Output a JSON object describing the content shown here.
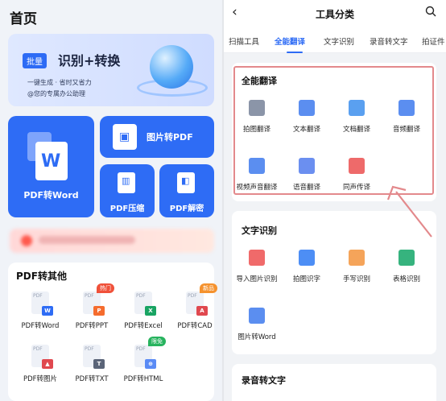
{
  "left": {
    "title": "首页",
    "banner": {
      "tag": "批量",
      "headline": "识别+转换",
      "line1": "一键生成 · 省时又省力",
      "line2": "@您的专属办公助理"
    },
    "cards": {
      "pdf_to_word": "PDF转Word",
      "image_to_pdf": "图片转PDF",
      "pdf_compress": "PDF压缩",
      "pdf_decrypt": "PDF解密"
    },
    "pdf_convert": {
      "title": "PDF转其他",
      "items": [
        {
          "label": "PDF转Word",
          "badge_letter": "W",
          "color": "#2e6cf5"
        },
        {
          "label": "PDF转PPT",
          "badge_letter": "P",
          "color": "#f56c2e",
          "tag": "热门"
        },
        {
          "label": "PDF转Excel",
          "badge_letter": "X",
          "color": "#19a463"
        },
        {
          "label": "PDF转CAD",
          "badge_letter": "A",
          "color": "#e0484f",
          "tag": "新品"
        },
        {
          "label": "PDF转图片",
          "badge_letter": "▲",
          "color": "#e0484f"
        },
        {
          "label": "PDF转TXT",
          "badge_letter": "T",
          "color": "#5a6478"
        },
        {
          "label": "PDF转HTML",
          "badge_letter": "⊕",
          "color": "#5a8bf5",
          "tag": "限免"
        }
      ]
    }
  },
  "right": {
    "title": "工具分类",
    "tabs": [
      "扫描工具",
      "全能翻译",
      "文字识别",
      "录音转文字",
      "拍证件"
    ],
    "active_tab": "全能翻译",
    "translation": {
      "title": "全能翻译",
      "items": [
        {
          "label": "拍图翻译",
          "icon": "camera-icon"
        },
        {
          "label": "文本翻译",
          "icon": "text-a-icon"
        },
        {
          "label": "文档翻译",
          "icon": "document-icon"
        },
        {
          "label": "音频翻译",
          "icon": "audio-icon"
        },
        {
          "label": "视频声音翻译",
          "icon": "video-icon"
        },
        {
          "label": "语音翻译",
          "icon": "microphone-icon"
        },
        {
          "label": "同声传译",
          "icon": "simultaneous-icon"
        }
      ]
    },
    "ocr": {
      "title": "文字识别",
      "items": [
        {
          "label": "导入图片识别",
          "icon": "image-import-icon"
        },
        {
          "label": "拍图识字",
          "icon": "scan-text-icon"
        },
        {
          "label": "手写识别",
          "icon": "handwriting-icon"
        },
        {
          "label": "表格识别",
          "icon": "table-icon"
        },
        {
          "label": "图片转Word",
          "icon": "image-to-word-icon"
        }
      ]
    },
    "audio": {
      "title": "录音转文字"
    }
  },
  "colors": {
    "accent": "#2d6bf5",
    "highlight_box": "#e3898c",
    "arrow": "#e3898c"
  }
}
